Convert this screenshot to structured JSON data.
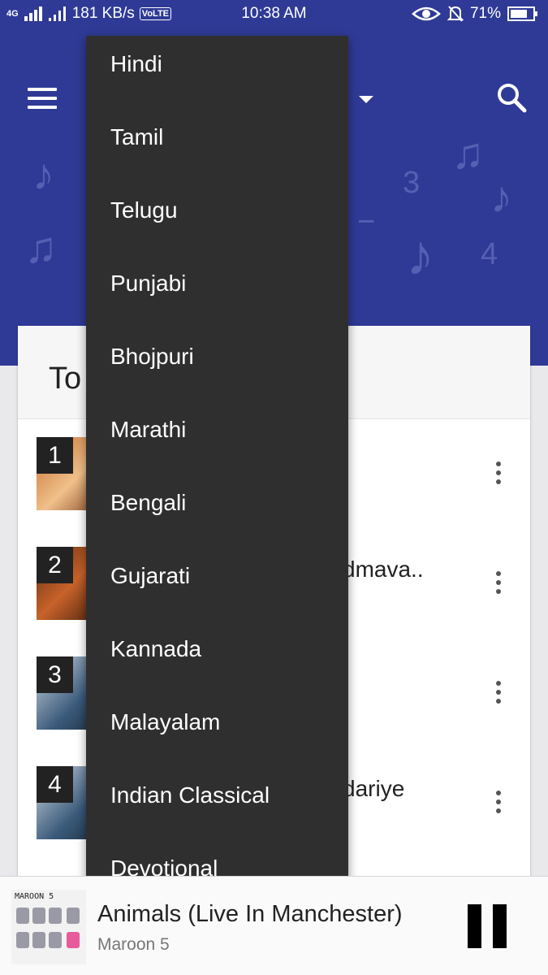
{
  "status_bar": {
    "network": "4G",
    "speed": "181 KB/s",
    "volte": "VoLTE",
    "time": "10:38 AM",
    "battery": "71%"
  },
  "header": {
    "icons": [
      "menu-icon",
      "search-icon",
      "dropdown-caret-icon"
    ],
    "colors": {
      "brand": "#2f3a96",
      "menu_bg": "#2f2f2f"
    }
  },
  "card": {
    "title": "To",
    "rows": [
      {
        "rank": "1",
        "title": ""
      },
      {
        "rank": "2",
        "title": "dmava.."
      },
      {
        "rank": "3",
        "title": ""
      },
      {
        "rank": "4",
        "title": "dariye"
      }
    ]
  },
  "language_menu": {
    "items": [
      "Hindi",
      "Tamil",
      "Telugu",
      "Punjabi",
      "Bhojpuri",
      "Marathi",
      "Bengali",
      "Gujarati",
      "Kannada",
      "Malayalam",
      "Indian Classical",
      "Devotional"
    ]
  },
  "player": {
    "art_label": "MAROON 5",
    "title": "Animals (Live In Manchester)",
    "artist": "Maroon 5"
  }
}
